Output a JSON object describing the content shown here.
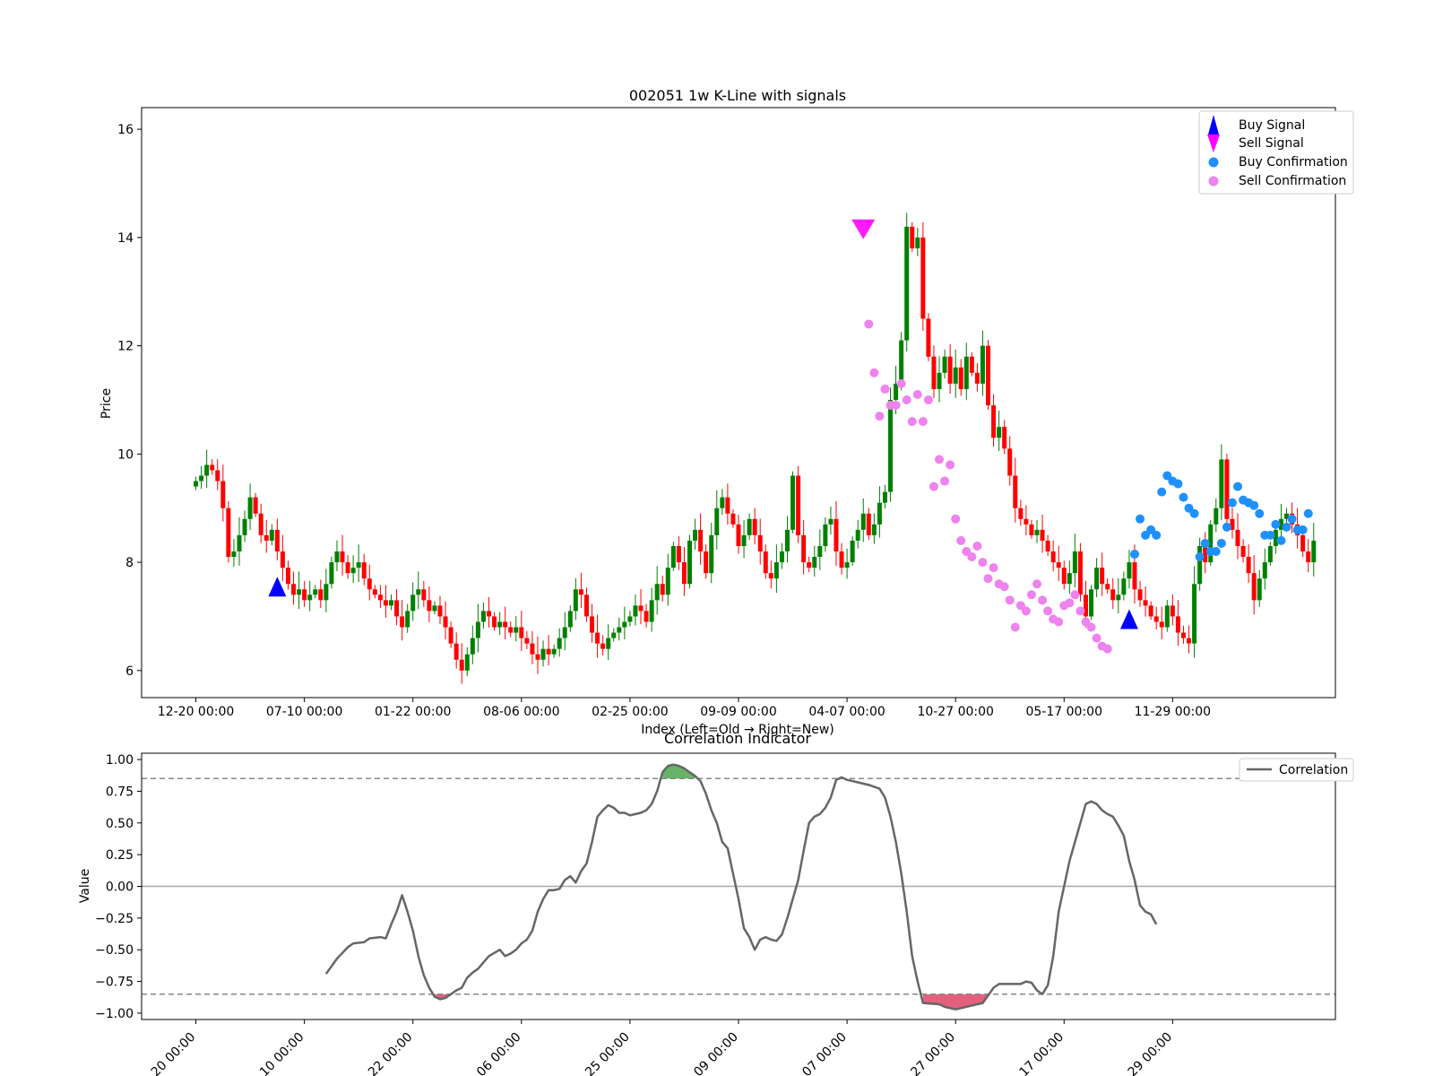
{
  "chart_data": [
    {
      "type": "candlestick",
      "title": "002051 1w K-Line with signals",
      "xlabel": "Index (Left=Old → Right=New)",
      "ylabel": "Price",
      "ylim": [
        5.5,
        16.4
      ],
      "xlim": [
        -10,
        210
      ],
      "yticks": [
        6,
        8,
        10,
        12,
        14,
        16
      ],
      "xticks": [
        {
          "x": 0,
          "label": "12-20 00:00"
        },
        {
          "x": 20,
          "label": "07-10 00:00"
        },
        {
          "x": 40,
          "label": "01-22 00:00"
        },
        {
          "x": 60,
          "label": "08-06 00:00"
        },
        {
          "x": 80,
          "label": "02-25 00:00"
        },
        {
          "x": 100,
          "label": "09-09 00:00"
        },
        {
          "x": 120,
          "label": "04-07 00:00"
        },
        {
          "x": 140,
          "label": "10-27 00:00"
        },
        {
          "x": 160,
          "label": "05-17 00:00"
        },
        {
          "x": 180,
          "label": "11-29 00:00"
        }
      ],
      "colors": {
        "up": "#008000",
        "down": "#ff0000",
        "buy_signal": "#0000ff",
        "sell_signal": "#ff00ff",
        "buy_confirm": "#1e90ff",
        "sell_confirm": "#ee82ee"
      },
      "grid": false,
      "legend_position": "top-right",
      "legend": [
        "Buy Signal",
        "Sell Signal",
        "Buy Confirmation",
        "Sell Confirmation"
      ],
      "close": [
        9.5,
        9.6,
        9.8,
        9.7,
        9.5,
        9.0,
        8.1,
        8.2,
        8.5,
        8.8,
        9.2,
        8.9,
        8.5,
        8.4,
        8.6,
        8.2,
        7.9,
        7.6,
        7.4,
        7.5,
        7.3,
        7.4,
        7.5,
        7.3,
        7.6,
        8.0,
        8.2,
        8.0,
        7.8,
        7.9,
        8.0,
        7.7,
        7.5,
        7.4,
        7.3,
        7.2,
        7.3,
        7.0,
        6.8,
        7.1,
        7.4,
        7.5,
        7.3,
        7.1,
        7.2,
        7.0,
        6.8,
        6.5,
        6.2,
        6.0,
        6.3,
        6.6,
        6.9,
        7.1,
        7.0,
        6.8,
        6.9,
        6.8,
        6.7,
        6.8,
        6.6,
        6.5,
        6.3,
        6.2,
        6.4,
        6.3,
        6.4,
        6.6,
        6.8,
        7.1,
        7.5,
        7.4,
        7.0,
        6.7,
        6.5,
        6.4,
        6.6,
        6.7,
        6.8,
        6.9,
        7.0,
        7.2,
        7.1,
        6.9,
        7.3,
        7.6,
        7.4,
        7.9,
        8.3,
        8.0,
        7.6,
        8.4,
        8.6,
        8.2,
        7.8,
        8.5,
        9.0,
        9.2,
        8.9,
        8.7,
        8.3,
        8.5,
        8.8,
        8.5,
        8.2,
        7.8,
        7.7,
        8.0,
        8.2,
        8.6,
        9.6,
        8.5,
        8.0,
        7.9,
        8.1,
        8.3,
        8.7,
        8.8,
        8.2,
        7.9,
        8.0,
        8.4,
        8.6,
        8.9,
        8.5,
        8.7,
        9.1,
        9.3,
        11.0,
        11.3,
        12.1,
        14.2,
        13.8,
        14.0,
        12.5,
        11.8,
        11.2,
        11.5,
        11.8,
        11.3,
        11.6,
        11.2,
        11.8,
        11.5,
        11.3,
        12.0,
        10.9,
        10.3,
        10.5,
        10.1,
        9.6,
        9.0,
        8.8,
        8.7,
        8.5,
        8.6,
        8.4,
        8.2,
        8.0,
        7.9,
        7.6,
        7.8,
        8.2,
        7.4,
        7.0,
        7.5,
        7.9,
        7.6,
        7.5,
        7.3,
        7.4,
        7.7,
        8.0,
        7.5,
        7.3,
        7.2,
        7.0,
        6.9,
        6.8,
        7.2,
        7.0,
        6.7,
        6.6,
        6.5,
        7.6,
        8.3,
        8.0,
        8.7,
        9.0,
        9.9,
        8.8,
        8.6,
        8.3,
        8.1,
        7.8,
        7.3,
        7.7,
        8.0,
        8.3,
        8.6,
        8.8,
        8.9,
        8.7,
        8.5,
        8.2,
        8.0,
        8.4
      ],
      "buy_signal": [
        {
          "x": 15,
          "y": 7.55
        },
        {
          "x": 172,
          "y": 6.95
        }
      ],
      "sell_signal": [
        {
          "x": 123,
          "y": 14.2
        }
      ],
      "sell_confirmation": [
        {
          "x": 124,
          "y": 12.4
        },
        {
          "x": 125,
          "y": 11.5
        },
        {
          "x": 126,
          "y": 10.7
        },
        {
          "x": 127,
          "y": 11.2
        },
        {
          "x": 128,
          "y": 10.9
        },
        {
          "x": 129,
          "y": 10.9
        },
        {
          "x": 130,
          "y": 11.3
        },
        {
          "x": 131,
          "y": 11.0
        },
        {
          "x": 132,
          "y": 10.6
        },
        {
          "x": 133,
          "y": 11.1
        },
        {
          "x": 134,
          "y": 10.6
        },
        {
          "x": 135,
          "y": 11.0
        },
        {
          "x": 136,
          "y": 9.4
        },
        {
          "x": 137,
          "y": 9.9
        },
        {
          "x": 138,
          "y": 9.5
        },
        {
          "x": 139,
          "y": 9.8
        },
        {
          "x": 140,
          "y": 8.8
        },
        {
          "x": 141,
          "y": 8.4
        },
        {
          "x": 142,
          "y": 8.2
        },
        {
          "x": 143,
          "y": 8.1
        },
        {
          "x": 144,
          "y": 8.3
        },
        {
          "x": 145,
          "y": 8.0
        },
        {
          "x": 146,
          "y": 7.7
        },
        {
          "x": 147,
          "y": 7.9
        },
        {
          "x": 148,
          "y": 7.6
        },
        {
          "x": 149,
          "y": 7.55
        },
        {
          "x": 150,
          "y": 7.3
        },
        {
          "x": 151,
          "y": 6.8
        },
        {
          "x": 152,
          "y": 7.2
        },
        {
          "x": 153,
          "y": 7.1
        },
        {
          "x": 154,
          "y": 7.4
        },
        {
          "x": 155,
          "y": 7.6
        },
        {
          "x": 156,
          "y": 7.3
        },
        {
          "x": 157,
          "y": 7.1
        },
        {
          "x": 158,
          "y": 6.95
        },
        {
          "x": 159,
          "y": 6.9
        },
        {
          "x": 160,
          "y": 7.2
        },
        {
          "x": 161,
          "y": 7.25
        },
        {
          "x": 162,
          "y": 7.4
        },
        {
          "x": 163,
          "y": 7.1
        },
        {
          "x": 164,
          "y": 6.9
        },
        {
          "x": 165,
          "y": 6.8
        },
        {
          "x": 166,
          "y": 6.6
        },
        {
          "x": 167,
          "y": 6.45
        },
        {
          "x": 168,
          "y": 6.4
        }
      ],
      "buy_confirmation": [
        {
          "x": 173,
          "y": 8.15
        },
        {
          "x": 174,
          "y": 8.8
        },
        {
          "x": 175,
          "y": 8.5
        },
        {
          "x": 176,
          "y": 8.6
        },
        {
          "x": 177,
          "y": 8.5
        },
        {
          "x": 178,
          "y": 9.3
        },
        {
          "x": 179,
          "y": 9.6
        },
        {
          "x": 180,
          "y": 9.5
        },
        {
          "x": 181,
          "y": 9.45
        },
        {
          "x": 182,
          "y": 9.2
        },
        {
          "x": 183,
          "y": 9.0
        },
        {
          "x": 184,
          "y": 8.9
        },
        {
          "x": 185,
          "y": 8.1
        },
        {
          "x": 186,
          "y": 8.35
        },
        {
          "x": 187,
          "y": 8.2
        },
        {
          "x": 188,
          "y": 8.2
        },
        {
          "x": 189,
          "y": 8.35
        },
        {
          "x": 190,
          "y": 8.65
        },
        {
          "x": 191,
          "y": 9.1
        },
        {
          "x": 192,
          "y": 9.4
        },
        {
          "x": 193,
          "y": 9.15
        },
        {
          "x": 194,
          "y": 9.1
        },
        {
          "x": 195,
          "y": 9.05
        },
        {
          "x": 196,
          "y": 8.9
        },
        {
          "x": 197,
          "y": 8.5
        },
        {
          "x": 198,
          "y": 8.5
        },
        {
          "x": 199,
          "y": 8.7
        },
        {
          "x": 200,
          "y": 8.4
        },
        {
          "x": 201,
          "y": 8.65
        },
        {
          "x": 202,
          "y": 8.8
        },
        {
          "x": 203,
          "y": 8.6
        },
        {
          "x": 204,
          "y": 8.6
        },
        {
          "x": 205,
          "y": 8.9
        }
      ]
    },
    {
      "type": "line",
      "title": "Correlation Indicator",
      "xlabel": "",
      "ylabel": "Value",
      "ylim": [
        -1.05,
        1.05
      ],
      "xlim": [
        -10,
        210
      ],
      "yticks": [
        1.0,
        0.75,
        0.5,
        0.25,
        0.0,
        -0.25,
        -0.5,
        -0.75,
        -1.0
      ],
      "ytick_labels": [
        "1.00",
        "0.75",
        "0.50",
        "0.25",
        "0.00",
        "−0.25",
        "−0.50",
        "−0.75",
        "−1.00"
      ],
      "xtick_labels_partial": [
        "20 00:00",
        "10 00:00",
        "22 00:00",
        "06 00:00",
        "25 00:00",
        "09 00:00",
        "07 00:00",
        "27 00:00",
        "17 00:00",
        "29 00:00"
      ],
      "xticks": [
        0,
        20,
        40,
        60,
        80,
        100,
        120,
        140,
        160,
        180
      ],
      "thresholds": [
        0.85,
        -0.85
      ],
      "legend": [
        "Correlation"
      ],
      "legend_position": "top-right",
      "colors": {
        "line": "#666666",
        "threshold": "#888888",
        "high_fill": "#4ca64c",
        "low_fill": "#e05070"
      },
      "series": [
        {
          "name": "Correlation",
          "points": [
            [
              24,
              -0.69
            ],
            [
              26,
              -0.57
            ],
            [
              28,
              -0.48
            ],
            [
              29,
              -0.45
            ],
            [
              31,
              -0.44
            ],
            [
              32,
              -0.41
            ],
            [
              34,
              -0.4
            ],
            [
              35,
              -0.41
            ],
            [
              36,
              -0.3
            ],
            [
              37,
              -0.2
            ],
            [
              38,
              -0.07
            ],
            [
              39,
              -0.2
            ],
            [
              40,
              -0.35
            ],
            [
              41,
              -0.55
            ],
            [
              42,
              -0.7
            ],
            [
              43,
              -0.8
            ],
            [
              44,
              -0.87
            ],
            [
              45,
              -0.89
            ],
            [
              46,
              -0.88
            ],
            [
              47,
              -0.85
            ],
            [
              48,
              -0.82
            ],
            [
              49,
              -0.8
            ],
            [
              50,
              -0.72
            ],
            [
              51,
              -0.68
            ],
            [
              52,
              -0.65
            ],
            [
              53,
              -0.6
            ],
            [
              54,
              -0.55
            ],
            [
              56,
              -0.5
            ],
            [
              57,
              -0.55
            ],
            [
              58,
              -0.53
            ],
            [
              59,
              -0.5
            ],
            [
              60,
              -0.45
            ],
            [
              61,
              -0.42
            ],
            [
              62,
              -0.35
            ],
            [
              63,
              -0.2
            ],
            [
              64,
              -0.1
            ],
            [
              65,
              -0.03
            ],
            [
              66,
              -0.03
            ],
            [
              67,
              -0.02
            ],
            [
              68,
              0.05
            ],
            [
              69,
              0.08
            ],
            [
              70,
              0.03
            ],
            [
              71,
              0.12
            ],
            [
              72,
              0.18
            ],
            [
              73,
              0.35
            ],
            [
              74,
              0.55
            ],
            [
              75,
              0.6
            ],
            [
              76,
              0.64
            ],
            [
              77,
              0.62
            ],
            [
              78,
              0.58
            ],
            [
              79,
              0.58
            ],
            [
              80,
              0.56
            ],
            [
              81,
              0.57
            ],
            [
              82,
              0.58
            ],
            [
              83,
              0.6
            ],
            [
              84,
              0.65
            ],
            [
              85,
              0.75
            ],
            [
              86,
              0.9
            ],
            [
              87,
              0.95
            ],
            [
              88,
              0.96
            ],
            [
              89,
              0.95
            ],
            [
              90,
              0.93
            ],
            [
              91,
              0.9
            ],
            [
              92,
              0.87
            ],
            [
              93,
              0.83
            ],
            [
              94,
              0.73
            ],
            [
              95,
              0.6
            ],
            [
              96,
              0.5
            ],
            [
              97,
              0.35
            ],
            [
              98,
              0.3
            ],
            [
              99,
              0.1
            ],
            [
              100,
              -0.1
            ],
            [
              101,
              -0.33
            ],
            [
              102,
              -0.4
            ],
            [
              103,
              -0.5
            ],
            [
              104,
              -0.42
            ],
            [
              105,
              -0.4
            ],
            [
              106,
              -0.42
            ],
            [
              107,
              -0.43
            ],
            [
              108,
              -0.38
            ],
            [
              109,
              -0.25
            ],
            [
              110,
              -0.1
            ],
            [
              111,
              0.05
            ],
            [
              112,
              0.28
            ],
            [
              113,
              0.5
            ],
            [
              114,
              0.55
            ],
            [
              115,
              0.57
            ],
            [
              116,
              0.62
            ],
            [
              117,
              0.7
            ],
            [
              118,
              0.84
            ],
            [
              119,
              0.86
            ],
            [
              120,
              0.84
            ],
            [
              122,
              0.82
            ],
            [
              124,
              0.8
            ],
            [
              126,
              0.77
            ],
            [
              127,
              0.7
            ],
            [
              128,
              0.55
            ],
            [
              129,
              0.35
            ],
            [
              130,
              0.1
            ],
            [
              131,
              -0.2
            ],
            [
              132,
              -0.55
            ],
            [
              133,
              -0.75
            ],
            [
              134,
              -0.92
            ],
            [
              137,
              -0.93
            ],
            [
              138,
              -0.95
            ],
            [
              140,
              -0.97
            ],
            [
              141,
              -0.96
            ],
            [
              143,
              -0.94
            ],
            [
              145,
              -0.92
            ],
            [
              146,
              -0.86
            ],
            [
              147,
              -0.8
            ],
            [
              148,
              -0.77
            ],
            [
              152,
              -0.77
            ],
            [
              153,
              -0.75
            ],
            [
              154,
              -0.76
            ],
            [
              155,
              -0.82
            ],
            [
              156,
              -0.85
            ],
            [
              157,
              -0.78
            ],
            [
              158,
              -0.55
            ],
            [
              159,
              -0.2
            ],
            [
              160,
              0.0
            ],
            [
              161,
              0.2
            ],
            [
              162,
              0.35
            ],
            [
              163,
              0.5
            ],
            [
              164,
              0.65
            ],
            [
              165,
              0.67
            ],
            [
              166,
              0.65
            ],
            [
              167,
              0.6
            ],
            [
              168,
              0.57
            ],
            [
              169,
              0.55
            ],
            [
              170,
              0.48
            ],
            [
              171,
              0.4
            ],
            [
              172,
              0.2
            ],
            [
              173,
              0.05
            ],
            [
              174,
              -0.15
            ],
            [
              175,
              -0.2
            ],
            [
              176,
              -0.22
            ],
            [
              177,
              -0.3
            ]
          ]
        }
      ]
    }
  ]
}
